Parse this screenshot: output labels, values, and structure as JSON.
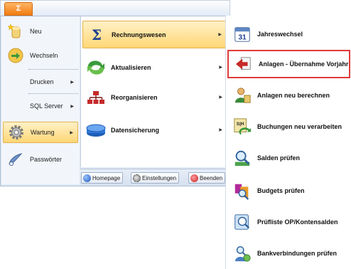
{
  "app_button": {
    "label": "Σ"
  },
  "left_menu": {
    "items": [
      {
        "label": "Neu",
        "icon": "new-document-icon",
        "has_submenu": false
      },
      {
        "label": "Wechseln",
        "icon": "switch-icon",
        "has_submenu": false
      },
      {
        "label": "Drucken",
        "has_submenu": true
      },
      {
        "label": "SQL Server",
        "has_submenu": true
      },
      {
        "label": "Wartung",
        "icon": "gear-icon",
        "has_submenu": true,
        "active": true
      },
      {
        "label": "Passwörter",
        "icon": "key-icon",
        "has_submenu": false
      }
    ]
  },
  "mid_menu": {
    "items": [
      {
        "label": "Rechnungswesen",
        "icon": "sigma-icon",
        "active": true
      },
      {
        "label": "Aktualisieren",
        "icon": "refresh-icon"
      },
      {
        "label": "Reorganisieren",
        "icon": "hierarchy-icon"
      },
      {
        "label": "Datensicherung",
        "icon": "database-icon"
      }
    ]
  },
  "footer": {
    "homepage": "Homepage",
    "einstellungen": "Einstellungen",
    "beenden": "Beenden"
  },
  "right_menu": {
    "items": [
      {
        "label": "Jahreswechsel",
        "icon": "calendar-icon",
        "icon_text": "31"
      },
      {
        "label": "Anlagen - Übernahme Vorjahr",
        "icon": "arrow-import-icon",
        "highlighted": true
      },
      {
        "label": "Anlagen neu berechnen",
        "icon": "person-calc-icon"
      },
      {
        "label": "Buchungen neu verarbeiten",
        "icon": "ledger-icon",
        "icon_text": "S|H"
      },
      {
        "label": "Salden prüfen",
        "icon": "magnifier-icon"
      },
      {
        "label": "Budgets prüfen",
        "icon": "budget-icon"
      },
      {
        "label": "Prüfliste OP/Kontensalden",
        "icon": "checklist-icon"
      },
      {
        "label": "Bankverbindungen prüfen",
        "icon": "bank-check-icon"
      }
    ]
  },
  "colors": {
    "accent": "#f07c12",
    "highlight_border": "#e03a3a",
    "active_bg": "#ffd776"
  }
}
